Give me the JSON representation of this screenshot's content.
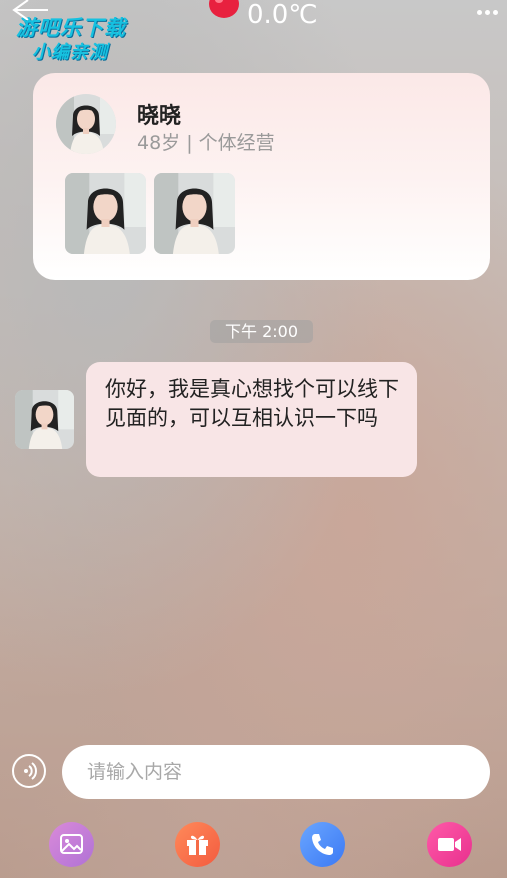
{
  "watermark": {
    "line1": "游吧乐下载",
    "line2": "小编亲测"
  },
  "status_bar": {
    "temperature": "0.0℃"
  },
  "profile": {
    "name": "晓晓",
    "meta": "48岁 | 个体经营",
    "photos": [
      "photo-1",
      "photo-2"
    ]
  },
  "chat": {
    "timestamp": "下午 2:00",
    "messages": [
      {
        "sender": "晓晓",
        "text": "你好，我是真心想找个可以线下见面的，可以互相认识一下吗"
      }
    ]
  },
  "composer": {
    "placeholder": "请输入内容"
  },
  "toolbar": {
    "items": [
      "image-icon",
      "gift-icon",
      "phone-icon",
      "video-icon"
    ]
  },
  "colors": {
    "bubble": "#f8e5e6",
    "card_top": "#fbe8e7",
    "image_btn": "#c07ad8",
    "gift_btn": "#f56b47",
    "call_btn": "#4a88f7",
    "video_btn": "#ee3d98"
  }
}
